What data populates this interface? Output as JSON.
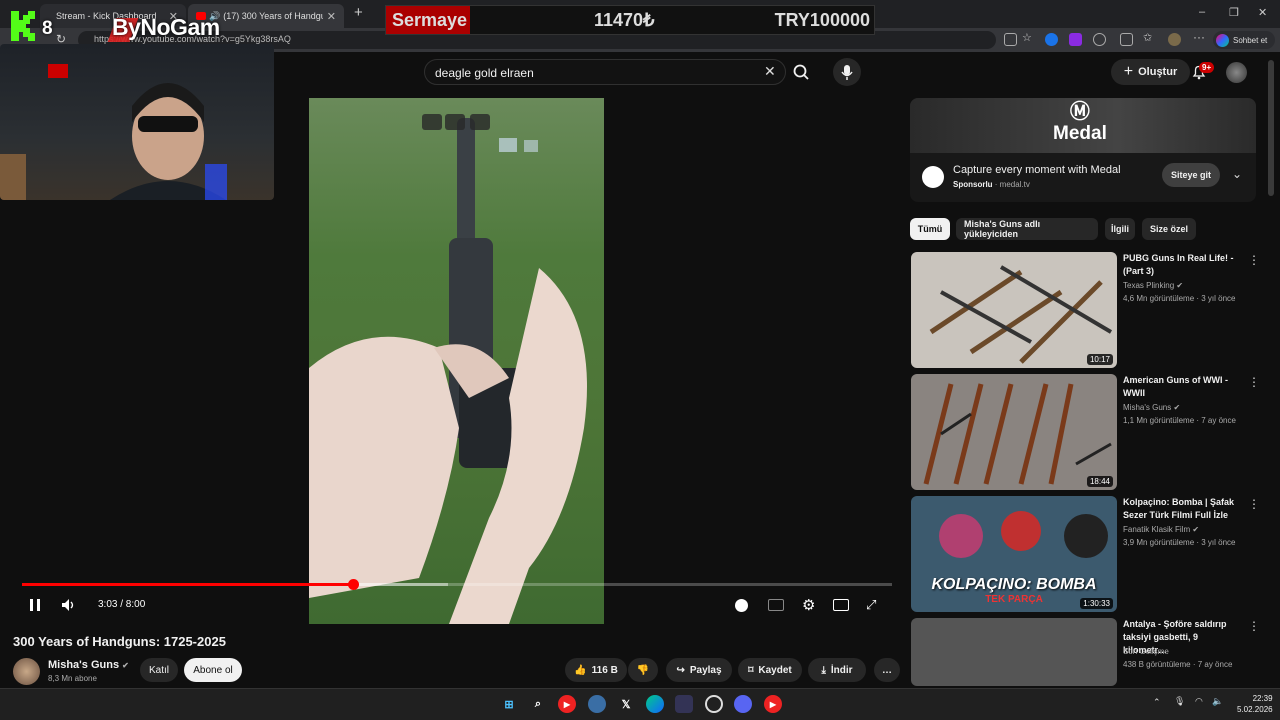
{
  "browser": {
    "tabs": [
      {
        "label": "Stream - Kick Dashboard"
      },
      {
        "label": "(17) 300 Years of Handguns: 1"
      }
    ],
    "url": "https://www.youtube.com/watch?v=g5Ykg38rsAQ",
    "new_tab": "+",
    "chat_button": "Sohbet et"
  },
  "overlay": {
    "kick_count": "8",
    "brand": "ByNoGam",
    "ticker": {
      "label": "Sermaye",
      "value": "11470₺",
      "target": "TRY100000"
    }
  },
  "youtube": {
    "search_query": "deagle gold elraen",
    "create_label": "Oluştur",
    "notif_count": "9+",
    "player": {
      "time": "3:03 / 8:00",
      "progress": 0.38,
      "buffered": 0.49
    },
    "video_title": "300 Years of Handguns: 1725-2025",
    "channel": {
      "name": "Misha's Guns",
      "subs": "8,3 Mn abone"
    },
    "join_label": "Katıl",
    "subscribe_label": "Abone ol",
    "actions": {
      "likes": "116 B",
      "share": "Paylaş",
      "save": "Kaydet",
      "download": "İndir",
      "more": "…"
    },
    "ad": {
      "brand": "Medal",
      "title": "Capture every moment with Medal",
      "sponsored": "Sponsorlu",
      "domain": "medal.tv",
      "button": "Siteye git"
    },
    "chips": [
      "Tümü",
      "Misha's Guns adlı yükleyiciden",
      "İlgili",
      "Size özel"
    ],
    "recommended": [
      {
        "title": "PUBG Guns In Real Life! - (Part 3)",
        "channel": "Texas Plinking",
        "meta": "4,6 Mn görüntüleme · 3 yıl önce",
        "duration": "10:17",
        "thumb_color": "#c9c4bd"
      },
      {
        "title": "American Guns of WWI - WWII",
        "channel": "Misha's Guns",
        "meta": "1,1 Mn görüntüleme · 7 ay önce",
        "duration": "18:44",
        "thumb_color": "#8a8480"
      },
      {
        "title": "Kolpaçino: Bomba | Şafak Sezer Türk Filmi Full İzle",
        "channel": "Fanatik Klasik Film",
        "meta": "3,9 Mn görüntüleme · 3 yıl önce",
        "duration": "1:30:33",
        "thumb_color": "#3c5a6e",
        "thumb_text": "KOLPAÇINO: BOMBA",
        "thumb_sub": "TEK PARÇA"
      },
      {
        "title": "Antalya - Şoföre saldırıp taksiyi gasbetti, 9 kilometr…",
        "channel": "Son Gelişme",
        "meta": "438 B görüntüleme · 7 ay önce",
        "duration": "",
        "thumb_color": "#555"
      }
    ]
  },
  "taskbar": {
    "time": "22:39",
    "date": "5.02.2026"
  }
}
